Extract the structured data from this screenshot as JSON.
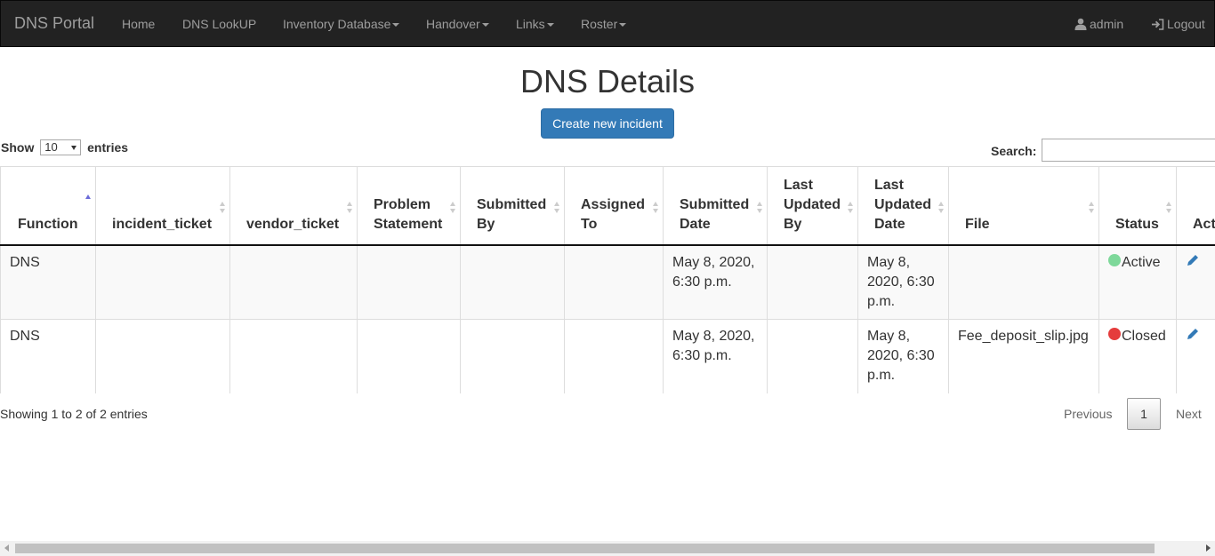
{
  "navbar": {
    "brand": "DNS Portal",
    "items": [
      {
        "label": "Home",
        "dropdown": false
      },
      {
        "label": "DNS LookUP",
        "dropdown": false
      },
      {
        "label": "Inventory Database",
        "dropdown": true
      },
      {
        "label": "Handover",
        "dropdown": true
      },
      {
        "label": "Links",
        "dropdown": true
      },
      {
        "label": "Roster",
        "dropdown": true
      }
    ],
    "user_label": "admin",
    "logout_label": "Logout"
  },
  "page": {
    "title": "DNS Details",
    "create_button": "Create new incident"
  },
  "table_controls": {
    "show_label": "Show",
    "entries_label": "entries",
    "page_length": "10",
    "search_label": "Search:",
    "search_value": ""
  },
  "table": {
    "columns": [
      {
        "label": "Function",
        "sort": "asc"
      },
      {
        "label": "incident_ticket",
        "sort": "none"
      },
      {
        "label": "vendor_ticket",
        "sort": "none"
      },
      {
        "label": "Problem Statement",
        "sort": "none"
      },
      {
        "label": "Submitted By",
        "sort": "none"
      },
      {
        "label": "Assigned To",
        "sort": "none"
      },
      {
        "label": "Submitted Date",
        "sort": "none"
      },
      {
        "label": "Last Updated By",
        "sort": "none"
      },
      {
        "label": "Last Updated Date",
        "sort": "none"
      },
      {
        "label": "File",
        "sort": "none"
      },
      {
        "label": "Status",
        "sort": "none"
      },
      {
        "label": "Act",
        "sort": "none"
      }
    ],
    "rows": [
      {
        "cells": [
          "DNS",
          "",
          "",
          "",
          "",
          "",
          "May 8, 2020, 6:30 p.m.",
          "",
          "May 8, 2020, 6:30 p.m.",
          ""
        ],
        "status": "Active",
        "status_color": "#7ed89a"
      },
      {
        "cells": [
          "DNS",
          "",
          "",
          "",
          "",
          "",
          "May 8, 2020, 6:30 p.m.",
          "",
          "May 8, 2020, 6:30 p.m.",
          "Fee_deposit_slip.jpg"
        ],
        "status": "Closed",
        "status_color": "#e53c3c"
      }
    ]
  },
  "footer": {
    "info": "Showing 1 to 2 of 2 entries",
    "previous": "Previous",
    "page": "1",
    "next": "Next"
  }
}
